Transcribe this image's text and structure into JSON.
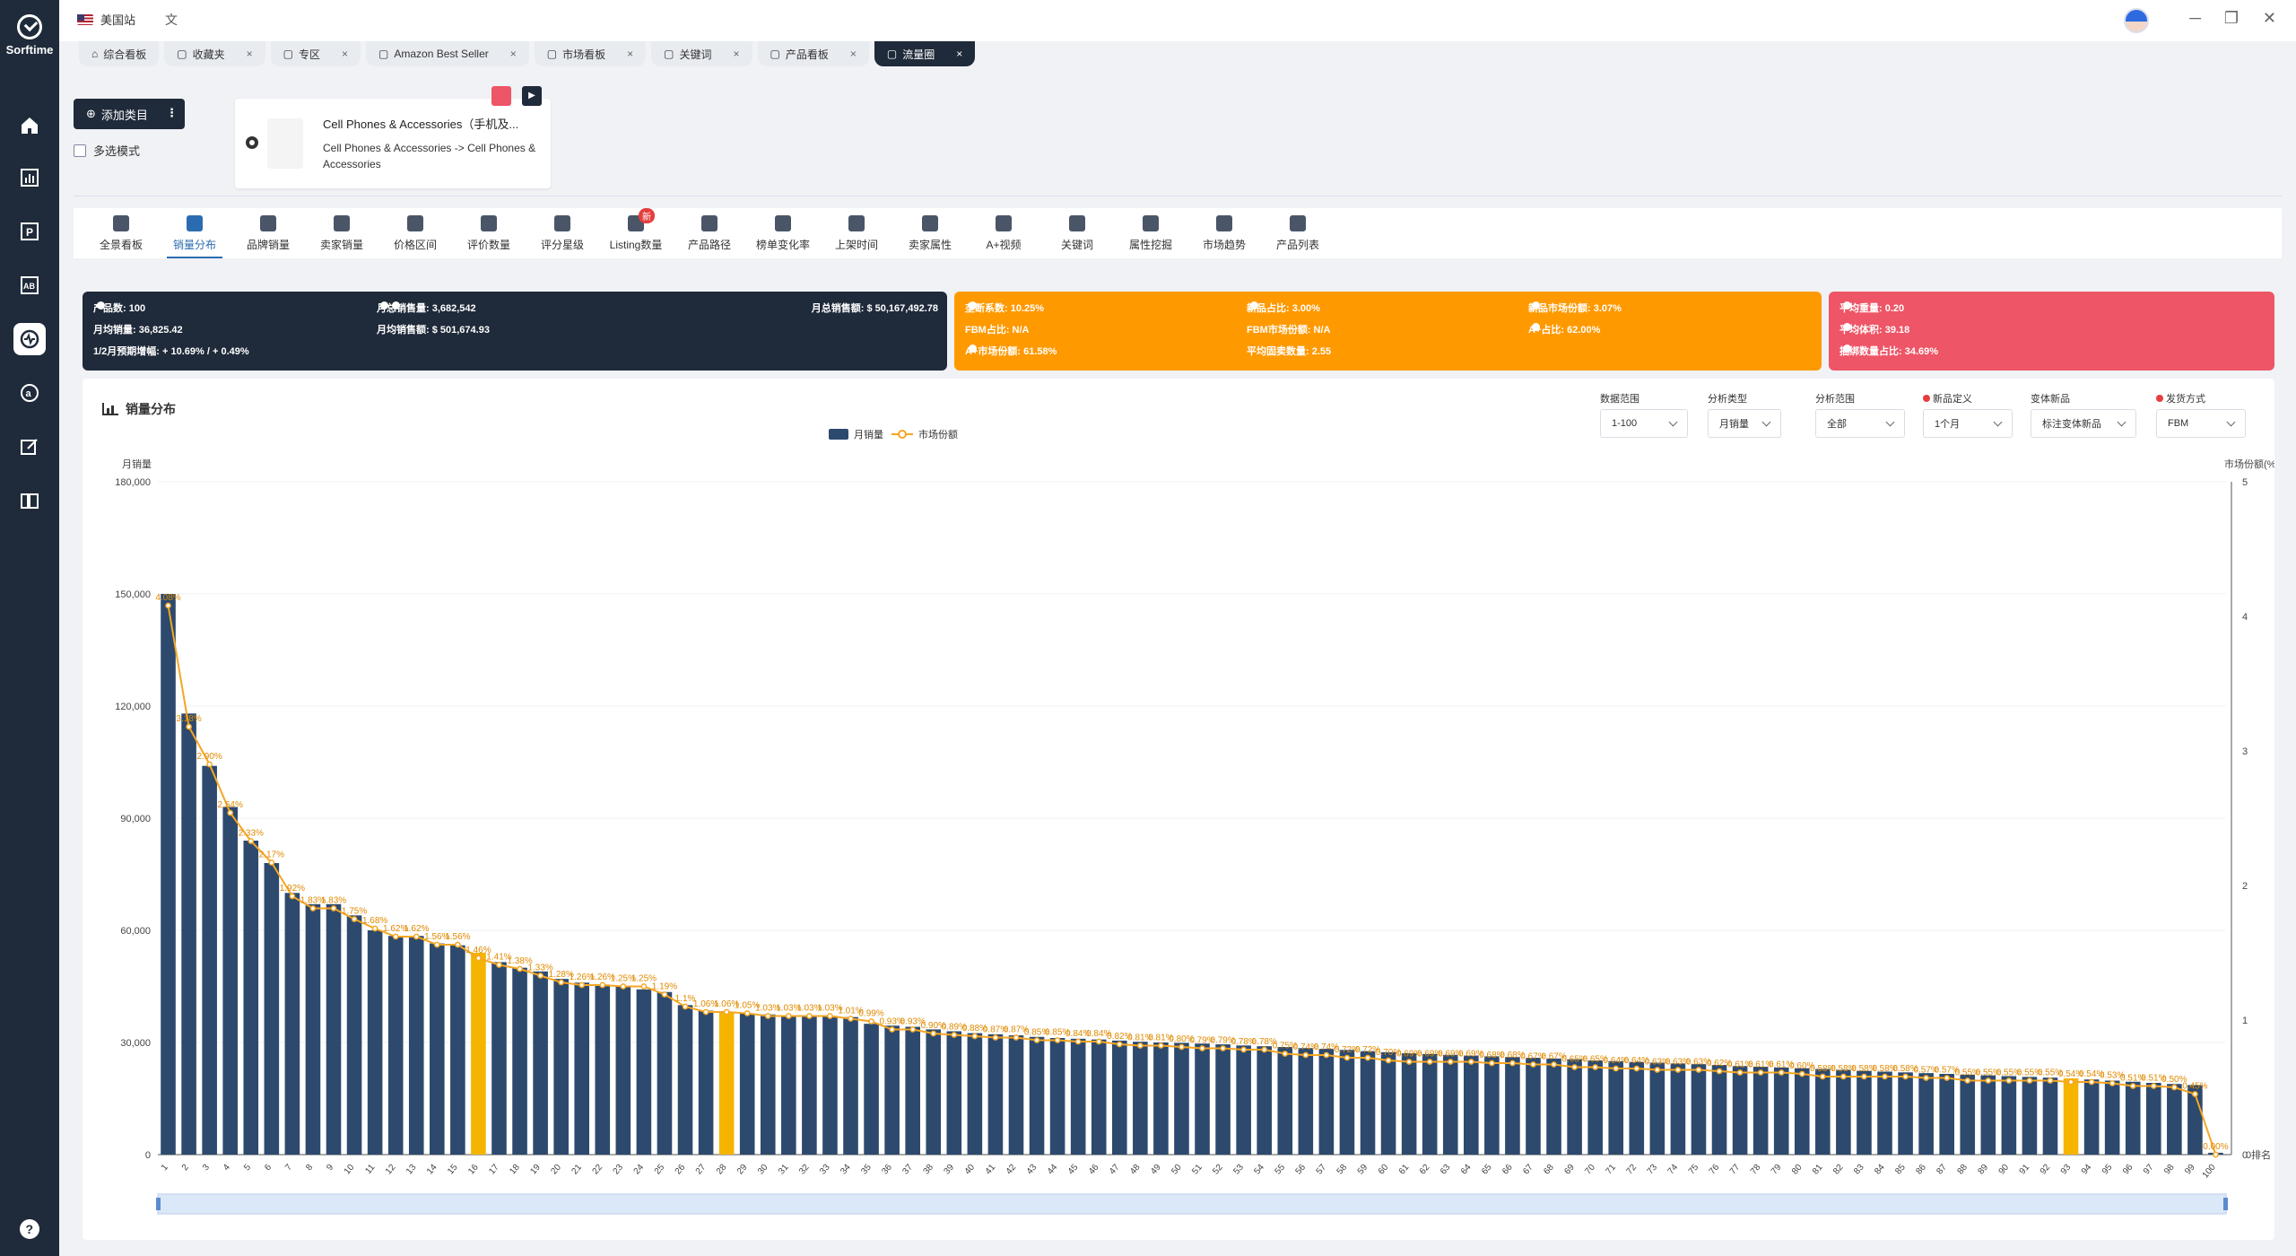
{
  "app": {
    "logo_text": "Sorftime",
    "region": "美国站",
    "translate_glyph": "文",
    "help": "?"
  },
  "sidebar_icons": [
    "home-icon",
    "chart-icon",
    "parking-icon",
    "ab-icon",
    "traffic-icon",
    "amazon-icon",
    "edit-icon",
    "book-icon"
  ],
  "tabs": [
    {
      "label": "综合看板",
      "closable": false
    },
    {
      "label": "收藏夹",
      "closable": true
    },
    {
      "label": "专区",
      "closable": true
    },
    {
      "label": "Amazon Best Seller",
      "closable": true
    },
    {
      "label": "市场看板",
      "closable": true
    },
    {
      "label": "关键词",
      "closable": true
    },
    {
      "label": "产品看板",
      "closable": true
    },
    {
      "label": "流量圈",
      "closable": true,
      "active": true
    }
  ],
  "toolbar": {
    "add_category": "添加类目",
    "multi_select": "多选模式"
  },
  "category_card": {
    "title": "Cell Phones & Accessories（手机及...",
    "path": "Cell Phones & Accessories -> Cell Phones & Accessories"
  },
  "features": [
    {
      "label": "全景看板"
    },
    {
      "label": "销量分布",
      "active": true
    },
    {
      "label": "品牌销量"
    },
    {
      "label": "卖家销量"
    },
    {
      "label": "价格区间"
    },
    {
      "label": "评价数量"
    },
    {
      "label": "评分星级"
    },
    {
      "label": "Listing数量",
      "badge": "新"
    },
    {
      "label": "产品路径"
    },
    {
      "label": "榜单变化率"
    },
    {
      "label": "上架时间"
    },
    {
      "label": "卖家属性"
    },
    {
      "label": "A+视频"
    },
    {
      "label": "关键词"
    },
    {
      "label": "属性挖掘"
    },
    {
      "label": "市场趋势"
    },
    {
      "label": "产品列表"
    }
  ],
  "stats": {
    "product_count": "产品数: 100",
    "monthly_sales_total": "月总销售量: 3,682,542",
    "monthly_revenue_total": "月总销售额: $ 50,167,492.78",
    "avg_monthly_sales": "月均销量: 36,825.42",
    "avg_monthly_revenue": "月均销售额: $ 501,674.93",
    "growth": "1/2月预期增幅: + 10.69% / + 0.49%",
    "monopoly": "垄断系数: 10.25%",
    "new_ratio": "新品占比: 3.00%",
    "new_share": "新品市场份额: 3.07%",
    "fbm_ratio": "FBM占比: N/A",
    "fbm_share": "FBM市场份额: N/A",
    "aplus_ratio": "A+占比: 62.00%",
    "aplus_share": "A+市场份额: 61.58%",
    "avg_sellers": "平均固卖数量: 2.55",
    "avg_weight": "平均重量: 0.20",
    "avg_volume": "平均体积: 39.18",
    "bundle_ratio": "捆绑数量占比: 34.69%"
  },
  "chart_panel": {
    "title": "销量分布",
    "filters": [
      {
        "label": "数据范围",
        "value": "1-100",
        "required": false
      },
      {
        "label": "分析类型",
        "value": "月销量",
        "required": false
      },
      {
        "label": "分析范围",
        "value": "全部",
        "required": false
      },
      {
        "label": "新品定义",
        "value": "1个月",
        "required": true
      },
      {
        "label": "变体新品",
        "value": "标注变体新品",
        "required": false
      },
      {
        "label": "发货方式",
        "value": "FBM",
        "required": true
      }
    ]
  },
  "chart_data": {
    "type": "bar",
    "ylabel_left": "月销量",
    "ylabel_right": "市场份额(%)",
    "xlabel": "0排名",
    "y_ticks": [
      "0",
      "30,000",
      "60,000",
      "90,000",
      "120,000",
      "150,000",
      "180,000"
    ],
    "y2_ticks": [
      "0",
      "1",
      "2",
      "3",
      "4",
      "5"
    ],
    "ylim": [
      0,
      180000
    ],
    "y2lim": [
      0,
      5
    ],
    "series": [
      {
        "name": "月销量",
        "type": "bar",
        "color": "#2d4a6e"
      },
      {
        "name": "市场份额",
        "type": "line",
        "color": "#f5a623"
      }
    ],
    "highlight_color": "#f5b400",
    "highlighted_ranks": [
      16,
      28,
      93
    ],
    "categories": [
      "1",
      "2",
      "3",
      "4",
      "5",
      "6",
      "7",
      "8",
      "9",
      "10",
      "11",
      "12",
      "13",
      "14",
      "15",
      "16",
      "17",
      "18",
      "19",
      "20",
      "21",
      "22",
      "23",
      "24",
      "25",
      "26",
      "27",
      "28",
      "29",
      "30",
      "31",
      "32",
      "33",
      "34",
      "35",
      "36",
      "37",
      "38",
      "39",
      "40",
      "41",
      "42",
      "43",
      "44",
      "45",
      "46",
      "47",
      "48",
      "49",
      "50",
      "51",
      "52",
      "53",
      "54",
      "55",
      "56",
      "57",
      "58",
      "59",
      "60",
      "61",
      "62",
      "63",
      "64",
      "65",
      "66",
      "67",
      "68",
      "69",
      "70",
      "71",
      "72",
      "73",
      "74",
      "75",
      "76",
      "77",
      "78",
      "79",
      "80",
      "81",
      "82",
      "83",
      "84",
      "85",
      "86",
      "87",
      "88",
      "89",
      "90",
      "91",
      "92",
      "93",
      "94",
      "95",
      "96",
      "97",
      "98",
      "99",
      "100"
    ],
    "values": [
      150000,
      118000,
      104000,
      93000,
      84000,
      78000,
      70000,
      67000,
      67000,
      64000,
      60000,
      58500,
      58500,
      56500,
      56000,
      54000,
      51500,
      50000,
      49000,
      47000,
      46000,
      45500,
      45000,
      44200,
      43500,
      40000,
      38500,
      38000,
      37800,
      37500,
      37300,
      37200,
      37100,
      36800,
      35000,
      34500,
      34200,
      33500,
      33000,
      32500,
      32200,
      31900,
      31500,
      31200,
      31000,
      30800,
      30500,
      30200,
      30000,
      29900,
      29700,
      29500,
      29200,
      29000,
      28800,
      28500,
      28300,
      28000,
      27700,
      27400,
      27100,
      26900,
      26700,
      26500,
      26300,
      26100,
      25900,
      25700,
      25500,
      25200,
      25000,
      24800,
      24600,
      24400,
      24200,
      24000,
      23700,
      23500,
      23300,
      23100,
      22900,
      22700,
      22400,
      22200,
      22000,
      21800,
      21600,
      21400,
      21200,
      21000,
      20800,
      20600,
      20400,
      20100,
      19800,
      19500,
      19200,
      18900,
      18600,
      500
    ],
    "share_labels": [
      "4.08%",
      "3.18%",
      "2.90%",
      "2.54%",
      "2.33%",
      "2.17%",
      "1.92%",
      "1.83%",
      "1.83%",
      "1.75%",
      "1.68%",
      "1.62%",
      "1.62%",
      "1.56%",
      "1.56%",
      "1.46%",
      "1.41%",
      "1.38%",
      "1.33%",
      "1.28%",
      "1.26%",
      "1.26%",
      "1.25%",
      "1.25%",
      "1.19%",
      "1.1%",
      "1.06%",
      "1.06%",
      "1.05%",
      "1.03%",
      "1.03%",
      "1.03%",
      "1.03%",
      "1.01%",
      "0.99%",
      "0.93%",
      "0.93%",
      "0.90%",
      "0.89%",
      "0.88%",
      "0.87%",
      "0.87%",
      "0.85%",
      "0.85%",
      "0.84%",
      "0.84%",
      "0.82%",
      "0.81%",
      "0.81%",
      "0.80%",
      "0.79%",
      "0.79%",
      "0.78%",
      "0.78%",
      "0.75%",
      "0.74%",
      "0.74%",
      "0.72%",
      "0.72%",
      "0.70%",
      "0.69%",
      "0.69%",
      "0.69%",
      "0.69%",
      "0.68%",
      "0.68%",
      "0.67%",
      "0.67%",
      "0.65%",
      "0.65%",
      "0.64%",
      "0.64%",
      "0.63%",
      "0.63%",
      "0.63%",
      "0.62%",
      "0.61%",
      "0.61%",
      "0.61%",
      "0.60%",
      "0.58%",
      "0.58%",
      "0.58%",
      "0.58%",
      "0.58%",
      "0.57%",
      "0.57%",
      "0.55%",
      "0.55%",
      "0.55%",
      "0.55%",
      "0.55%",
      "0.54%",
      "0.54%",
      "0.53%",
      "0.51%",
      "0.51%",
      "0.50%",
      "0.45%",
      "0.00%"
    ]
  },
  "colors": {
    "dark": "#1f2a3a",
    "orange": "#ff9900",
    "red": "#ee5566",
    "bar": "#2d4a6e",
    "line": "#f5a623"
  }
}
